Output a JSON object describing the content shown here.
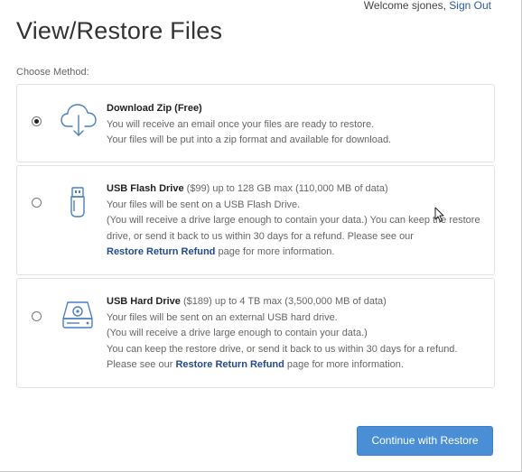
{
  "header": {
    "welcome": "Welcome sjones,",
    "sign_out": "Sign Out"
  },
  "page": {
    "title": "View/Restore Files",
    "method_label": "Choose Method:"
  },
  "options": [
    {
      "title": "Download Zip (Free)",
      "lines": [
        "You will receive an email once your files are ready to restore.",
        "Your files will be put into a zip format and available for download."
      ],
      "selected": true,
      "icon": "cloud-download-icon"
    },
    {
      "title": "USB Flash Drive",
      "title_suffix": "($99) up to 128 GB max (110,000 MB of data)",
      "lines": [
        "Your files will be sent on a USB Flash Drive.",
        "(You will receive a drive large enough to contain your data.) You can keep the restore drive, or send it back to us within 30 days for a refund. Please see our"
      ],
      "link": "Restore Return Refund",
      "after_link": "page for more information.",
      "selected": false,
      "icon": "usb-flash-drive-icon"
    },
    {
      "title": "USB Hard Drive",
      "title_suffix": "($189) up to 4 TB max (3,500,000 MB of data)",
      "lines": [
        "Your files will be sent on an external USB hard drive.",
        "(You will receive a drive large enough to contain your data.)",
        "You can keep the restore drive, or send it back to us within 30 days for a refund.",
        "Please see our"
      ],
      "link": "Restore Return Refund",
      "after_link": "page for more information.",
      "selected": false,
      "icon": "usb-hard-drive-icon"
    }
  ],
  "actions": {
    "continue_label": "Continue with Restore"
  },
  "colors": {
    "accent": "#4a8fd6",
    "link": "#234a8c"
  }
}
